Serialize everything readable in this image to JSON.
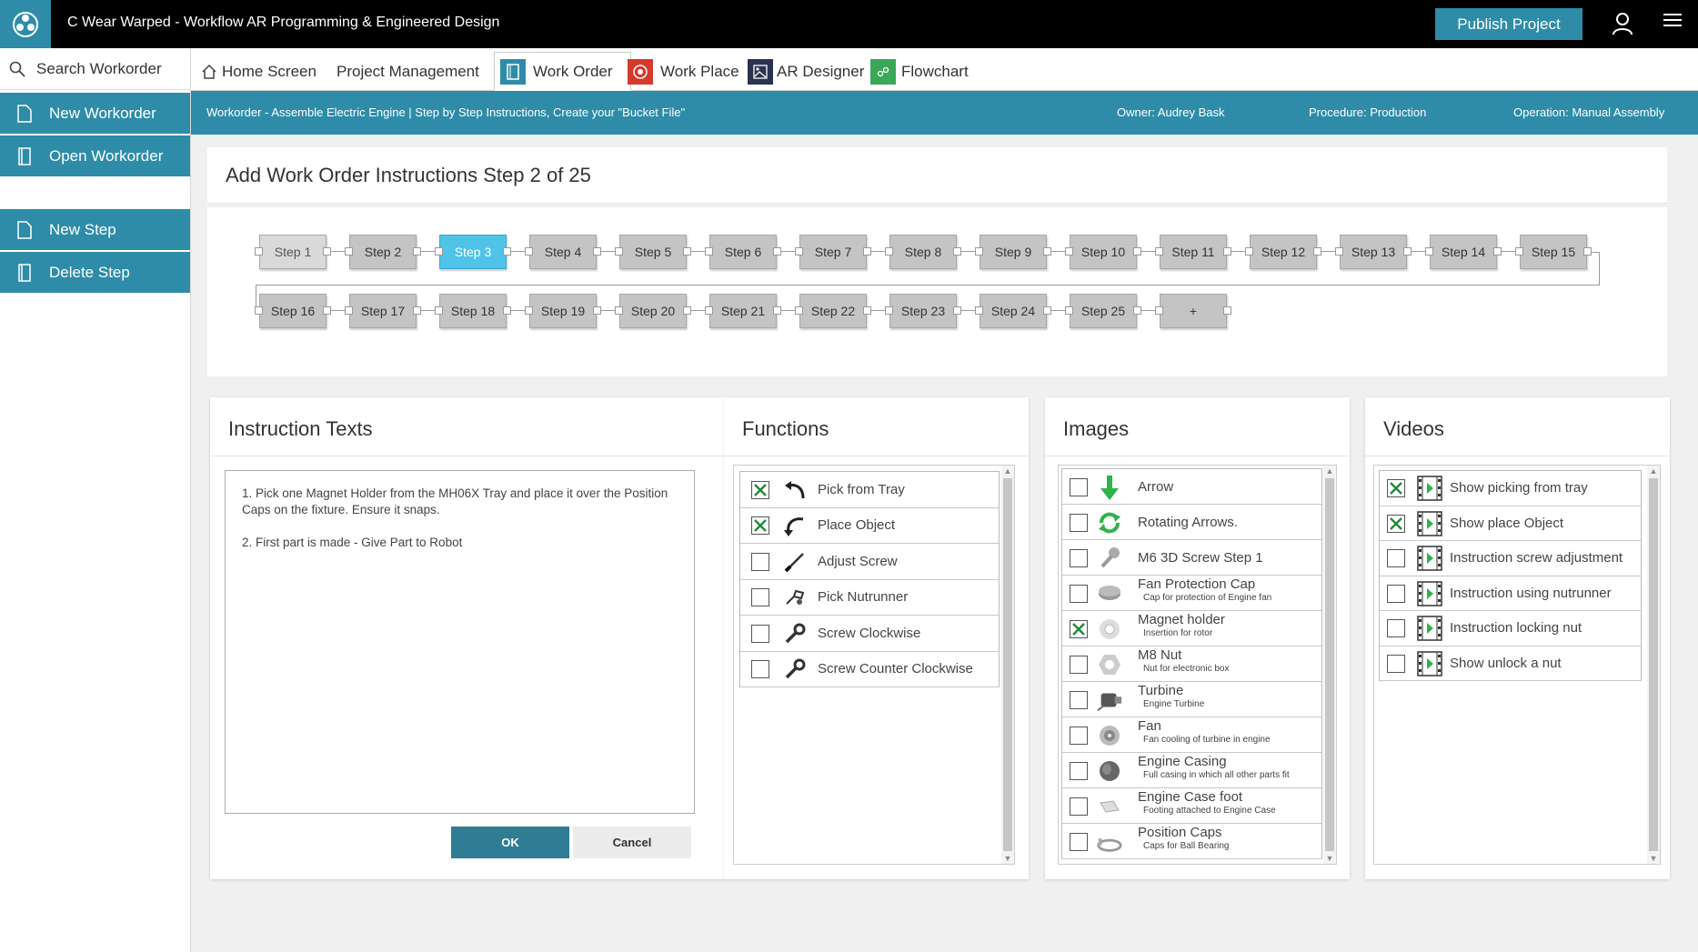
{
  "app": {
    "title": "C Wear Warped - Workflow AR Programming & Engineered Design",
    "publish_label": "Publish Project",
    "brand_color": "#2e8ca8"
  },
  "sidebar": {
    "search_label": "Search Workorder",
    "buttons": [
      {
        "label": "New Workorder",
        "icon": "file-icon"
      },
      {
        "label": "Open Workorder",
        "icon": "book-icon"
      },
      {
        "label": "New Step",
        "icon": "file-icon"
      },
      {
        "label": "Delete Step",
        "icon": "book-icon"
      }
    ]
  },
  "tabs": [
    {
      "label": "Home Screen",
      "icon": "home-icon"
    },
    {
      "label": "Project Management",
      "icon": ""
    },
    {
      "label": "Work Order",
      "icon": "work-order-icon",
      "active": true
    },
    {
      "label": "Work Place",
      "icon": "target-icon"
    },
    {
      "label": "AR Designer",
      "icon": "image-icon"
    },
    {
      "label": "Flowchart",
      "icon": "flowchart-icon"
    }
  ],
  "infobar": {
    "workorder": "Workorder - Assemble Electric Engine | Step by Step Instructions, Create your \"Bucket File\"",
    "owner": "Owner: Audrey Bask",
    "procedure": "Procedure: Production",
    "operation": "Operation: Manual Assembly"
  },
  "steps": {
    "heading": "Add Work Order Instructions Step 2 of 25",
    "row1": [
      "Step 1",
      "Step 2",
      "Step 3",
      "Step 4",
      "Step 5",
      "Step 6",
      "Step 7",
      "Step 8",
      "Step 9",
      "Step 10",
      "Step 11",
      "Step 12",
      "Step 13",
      "Step 14",
      "Step 15"
    ],
    "row2": [
      "Step 16",
      "Step 17",
      "Step 18",
      "Step 19",
      "Step 20",
      "Step 21",
      "Step 22",
      "Step 23",
      "Step 24",
      "Step 25",
      "+"
    ],
    "active": "Step 3"
  },
  "instruction": {
    "title": "Instruction Texts",
    "line1": "1. Pick one Magnet Holder from the MH06X Tray and place it over the Position Caps on the fixture. Ensure it snaps.",
    "line2": "2. First part is made - Give Part to Robot",
    "ok_label": "OK",
    "cancel_label": "Cancel"
  },
  "functions": {
    "title": "Functions",
    "items": [
      {
        "label": "Pick from Tray",
        "checked": true,
        "icon": "curved-arrow-up-icon"
      },
      {
        "label": "Place Object",
        "checked": true,
        "icon": "curved-arrow-down-icon"
      },
      {
        "label": "Adjust Screw",
        "checked": false,
        "icon": "screwdriver-icon"
      },
      {
        "label": "Pick Nutrunner",
        "checked": false,
        "icon": "nutrunner-icon"
      },
      {
        "label": "Screw Clockwise",
        "checked": false,
        "icon": "wrench-icon"
      },
      {
        "label": "Screw Counter Clockwise",
        "checked": false,
        "icon": "wrench-icon"
      }
    ]
  },
  "images": {
    "title": "Images",
    "items": [
      {
        "label": "Arrow",
        "sub": "",
        "checked": false,
        "icon": "green-arrow-icon"
      },
      {
        "label": "Rotating Arrows.",
        "sub": "",
        "checked": false,
        "icon": "rotating-arrows-icon"
      },
      {
        "label": "M6 3D Screw Step 1",
        "sub": "",
        "checked": false,
        "icon": "screw-icon"
      },
      {
        "label": "Fan Protection Cap",
        "sub": "Cap for protection of Engine fan",
        "checked": false,
        "icon": "cap-icon"
      },
      {
        "label": "Magnet holder",
        "sub": "Insertion for rotor",
        "checked": true,
        "icon": "magnet-holder-icon"
      },
      {
        "label": "M8 Nut",
        "sub": "Nut for electronic box",
        "checked": false,
        "icon": "nut-icon"
      },
      {
        "label": "Turbine",
        "sub": "Engine Turbine",
        "checked": false,
        "icon": "turbine-icon"
      },
      {
        "label": "Fan",
        "sub": "Fan cooling of turbine in engine",
        "checked": false,
        "icon": "fan-icon"
      },
      {
        "label": "Engine Casing",
        "sub": "Full casing in which all other parts fit",
        "checked": false,
        "icon": "casing-icon"
      },
      {
        "label": "Engine Case foot",
        "sub": "Footing attached to Engine Case",
        "checked": false,
        "icon": "foot-icon"
      },
      {
        "label": "Position Caps",
        "sub": "Caps for Ball Bearing",
        "checked": false,
        "icon": "position-caps-icon"
      }
    ]
  },
  "videos": {
    "title": "Videos",
    "items": [
      {
        "label": "Show picking from tray",
        "checked": true,
        "icon": "video-icon"
      },
      {
        "label": "Show place Object",
        "checked": true,
        "icon": "video-icon"
      },
      {
        "label": "Instruction screw adjustment",
        "checked": false,
        "icon": "video-icon"
      },
      {
        "label": "Instruction using nutrunner",
        "checked": false,
        "icon": "video-icon"
      },
      {
        "label": "Instruction locking nut",
        "checked": false,
        "icon": "video-icon"
      },
      {
        "label": "Show unlock a nut",
        "checked": false,
        "icon": "video-icon"
      }
    ]
  }
}
